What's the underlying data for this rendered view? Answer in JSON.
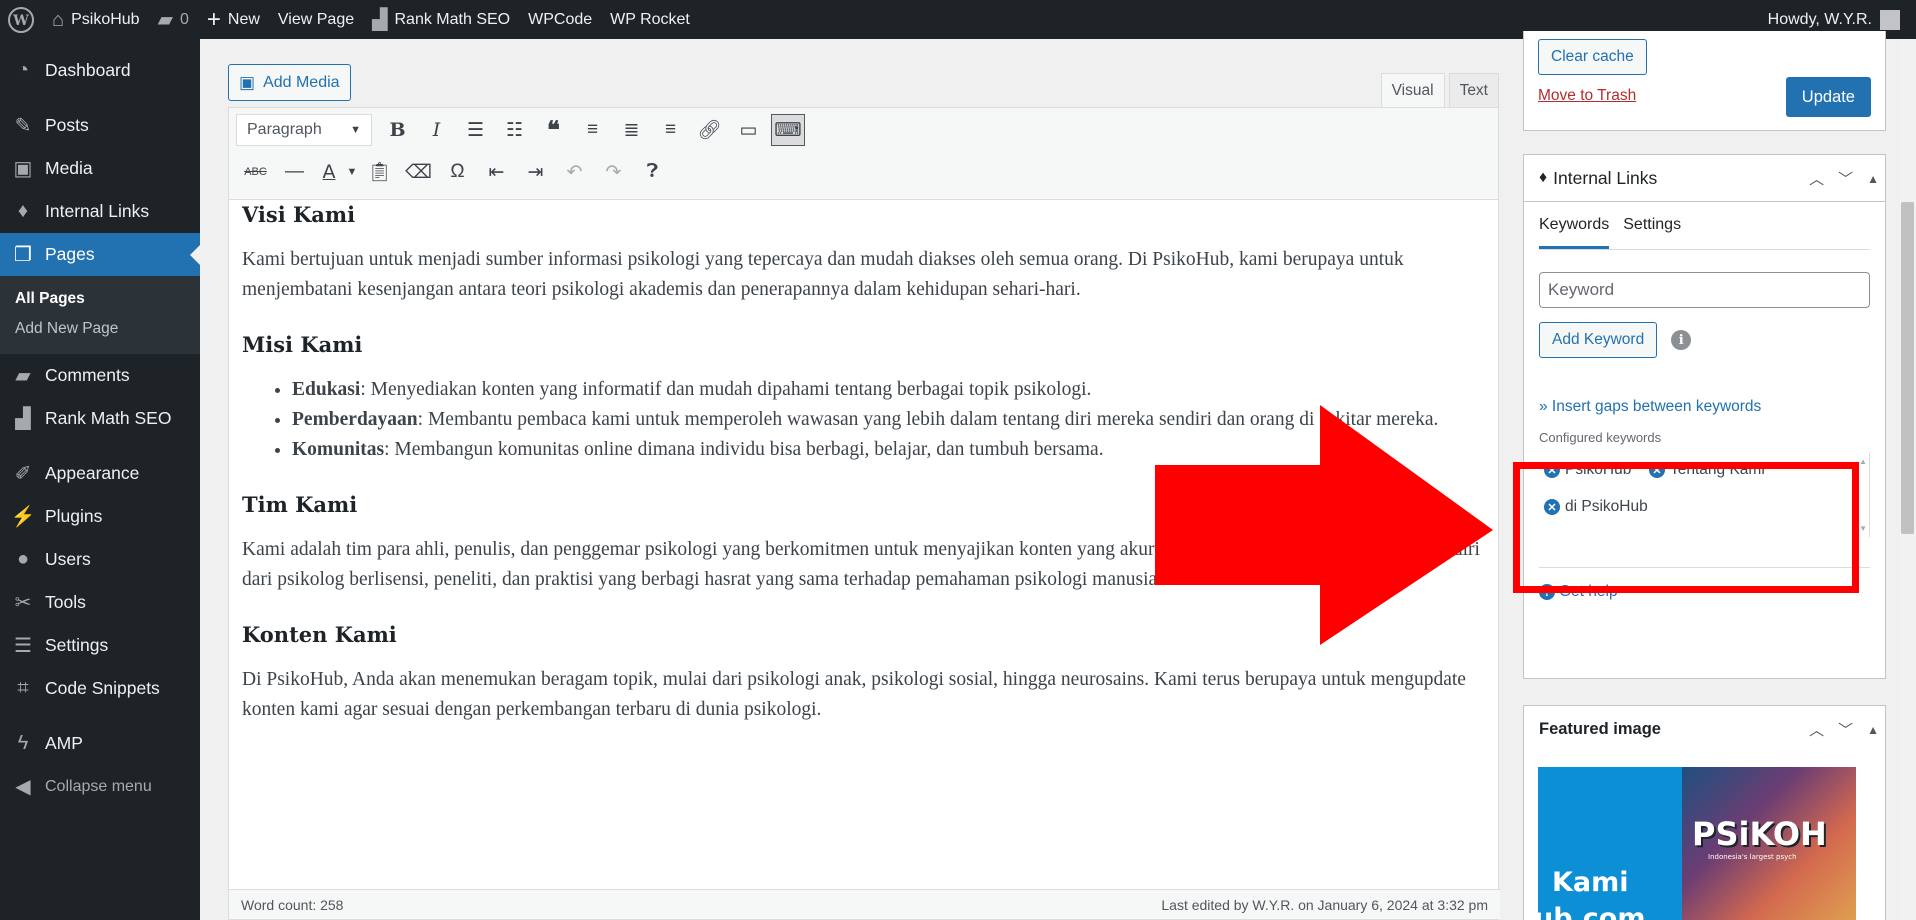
{
  "adminbar": {
    "site_name": "PsikoHub",
    "comments_count": "0",
    "new_label": "New",
    "view_page_label": "View Page",
    "rank_math_label": "Rank Math SEO",
    "wpcode_label": "WPCode",
    "wp_rocket_label": "WP Rocket",
    "howdy_label": "Howdy, W.Y.R."
  },
  "sidebar": {
    "dashboard": "Dashboard",
    "posts": "Posts",
    "media": "Media",
    "internal_links": "Internal Links",
    "pages": "Pages",
    "all_pages": "All Pages",
    "add_new_page": "Add New Page",
    "comments": "Comments",
    "rank_math_seo": "Rank Math SEO",
    "appearance": "Appearance",
    "plugins": "Plugins",
    "users": "Users",
    "tools": "Tools",
    "settings": "Settings",
    "code_snippets": "Code Snippets",
    "amp": "AMP",
    "collapse_menu": "Collapse menu"
  },
  "editor": {
    "add_media_label": "Add Media",
    "tab_visual": "Visual",
    "tab_text": "Text",
    "format_select": "Paragraph",
    "word_count": "Word count: 258",
    "last_edited": "Last edited by W.Y.R. on January 6, 2024 at 3:32 pm",
    "content": {
      "h_visi": "Visi Kami",
      "p_visi": "Kami bertujuan untuk menjadi sumber informasi psikologi yang tepercaya dan mudah diakses oleh semua orang. Di PsikoHub, kami berupaya untuk menjembatani kesenjangan antara teori psikologi akademis dan penerapannya dalam kehidupan sehari-hari.",
      "h_misi": "Misi Kami",
      "li1_bold": "Edukasi",
      "li1_text": ": Menyediakan konten yang informatif dan mudah dipahami tentang berbagai topik psikologi.",
      "li2_bold": "Pemberdayaan",
      "li2_text": ": Membantu pembaca kami untuk memperoleh wawasan yang lebih dalam tentang diri mereka sendiri dan orang di sekitar mereka.",
      "li3_bold": "Komunitas",
      "li3_text": ": Membangun komunitas online dimana individu bisa berbagi, belajar, dan tumbuh bersama.",
      "h_tim": "Tim Kami",
      "p_tim": "Kami adalah tim para ahli, penulis, dan penggemar psikologi yang berkomitmen untuk menyajikan konten yang akurat, relevan, dan menarik. Tim kami terdiri dari psikolog berlisensi, peneliti, dan praktisi yang berbagi hasrat yang sama terhadap pemahaman psikologi manusia.",
      "h_konten": "Konten Kami",
      "p_konten": "Di PsikoHub, Anda akan menemukan beragam topik, mulai dari psikologi anak, psikologi sosial, hingga neurosains. Kami terus berupaya untuk mengupdate konten kami agar sesuai dengan perkembangan terbaru di dunia psikologi."
    }
  },
  "publish": {
    "clear_cache": "Clear cache",
    "move_to_trash": "Move to Trash",
    "update": "Update"
  },
  "internal_links": {
    "title": "Internal Links",
    "tab_keywords": "Keywords",
    "tab_settings": "Settings",
    "keyword_placeholder": "Keyword",
    "add_keyword": "Add Keyword",
    "insert_gaps": "» Insert gaps between keywords",
    "configured_label": "Configured keywords",
    "keywords": [
      "PsikoHub",
      "Tentang Kami",
      "di PsikoHub"
    ],
    "get_help": "Get help"
  },
  "featured": {
    "title": "Featured image",
    "image_text_left_1": "Kami",
    "image_text_left_2": "ub.com",
    "image_text_right": "PSiKOH",
    "image_tagline": "Indonesia's largest psych"
  },
  "colors": {
    "accent": "#2271b1",
    "admin_dark": "#1d2327",
    "annotation_red": "#ff0000"
  }
}
